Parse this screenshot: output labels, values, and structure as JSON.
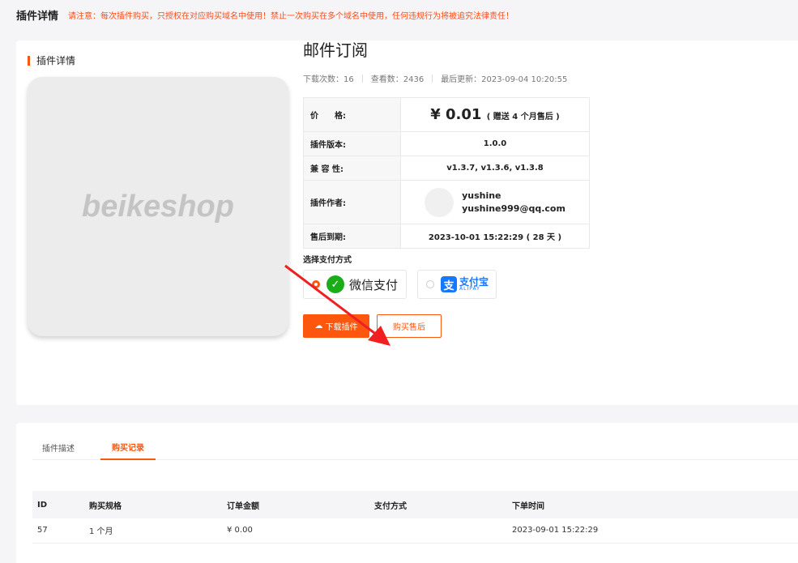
{
  "header": {
    "title": "插件详情",
    "notice": "请注意：每次插件购买，只授权在对应购买域名中使用！禁止一次购买在多个域名中使用，任何违规行为将被追究法律责任！"
  },
  "detail": {
    "section_title": "插件详情",
    "thumbnail_text": "beikeshop",
    "name": "邮件订阅",
    "stats": {
      "downloads": "下载次数：16",
      "views": "查看数：2436",
      "updated": "最后更新：2023-09-04 10:20:55"
    },
    "table": {
      "price_label": "价　　格:",
      "price_value": "¥ 0.01",
      "price_note": "( 赠送 4 个月售后 )",
      "version_label": "插件版本:",
      "version_value": "1.0.0",
      "compat_label": "兼 容 性:",
      "compat_value": "v1.3.7, v1.3.6, v1.3.8",
      "author_label": "插件作者:",
      "author_name": "yushine",
      "author_email": "yushine999@qq.com",
      "expire_label": "售后到期:",
      "expire_value": "2023-10-01 15:22:29 ( 28 天 )"
    },
    "payment": {
      "label": "选择支付方式",
      "wechat": "微信支付",
      "alipay_cn": "支付宝",
      "alipay_en": "ALIPAY",
      "selected": "wechat"
    },
    "buttons": {
      "download": "下载插件",
      "buy_after_sales": "购买售后"
    }
  },
  "records": {
    "tabs": [
      "插件描述",
      "购买记录"
    ],
    "active_tab": "购买记录",
    "columns": [
      "ID",
      "购买规格",
      "订单金额",
      "支付方式",
      "下单时间"
    ],
    "rows": [
      [
        "57",
        "1 个月",
        "¥ 0.00",
        "",
        "2023-09-01 15:22:29"
      ]
    ]
  },
  "colors": {
    "accent": "#fd560f",
    "wechat": "#1aad19",
    "alipay": "#1677ff",
    "annotation_arrow": "#f02020"
  }
}
